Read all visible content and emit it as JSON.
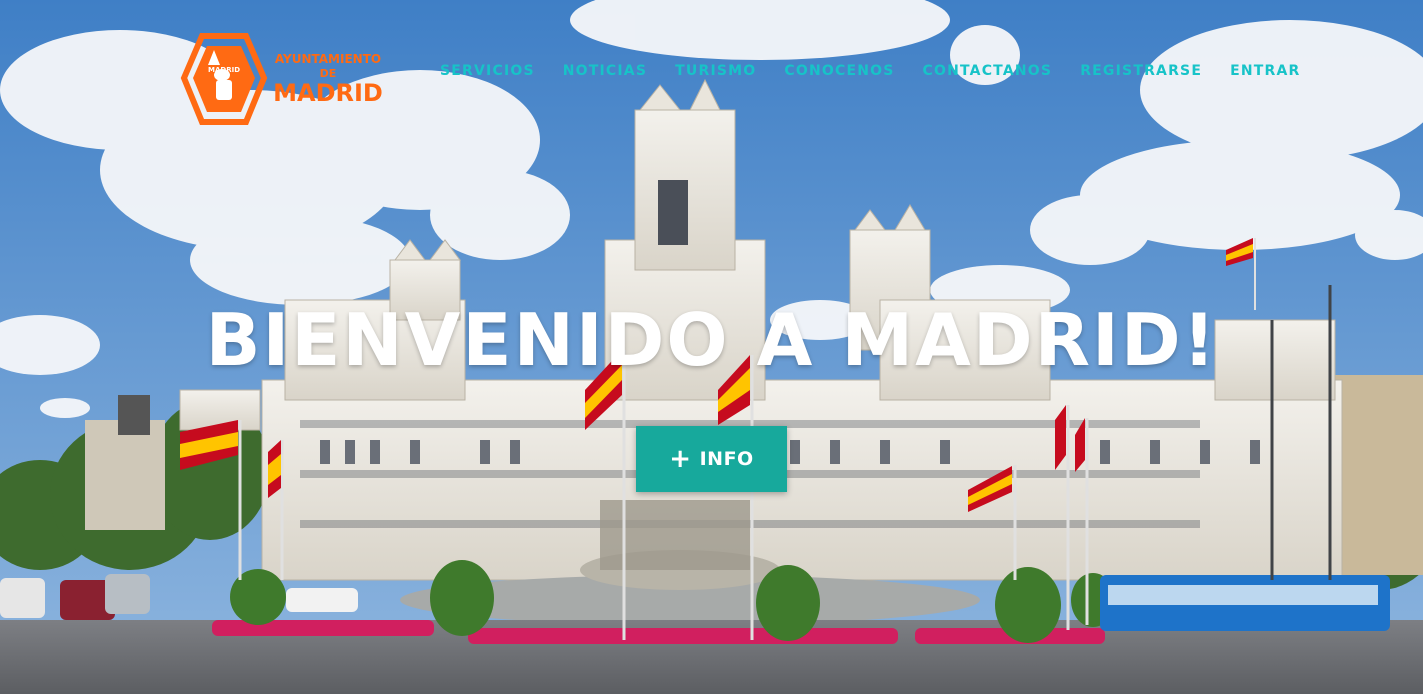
{
  "logo": {
    "top_text": "MADRID",
    "line1": "AYUNTAMIENTO",
    "line2": "DE",
    "line3": "MADRID",
    "color": "#ff6a13"
  },
  "nav": {
    "color": "#17c3c8",
    "items": [
      "SERVICIOS",
      "NOTICIAS",
      "TURISMO",
      "CONOCENOS",
      "CONTACTANOS",
      "REGISTRARSE",
      "ENTRAR"
    ]
  },
  "hero": {
    "title": "BIENVENIDO A MADRID!",
    "button_label": "INFO",
    "button_icon": "plus-icon",
    "button_color": "#17a99c"
  }
}
